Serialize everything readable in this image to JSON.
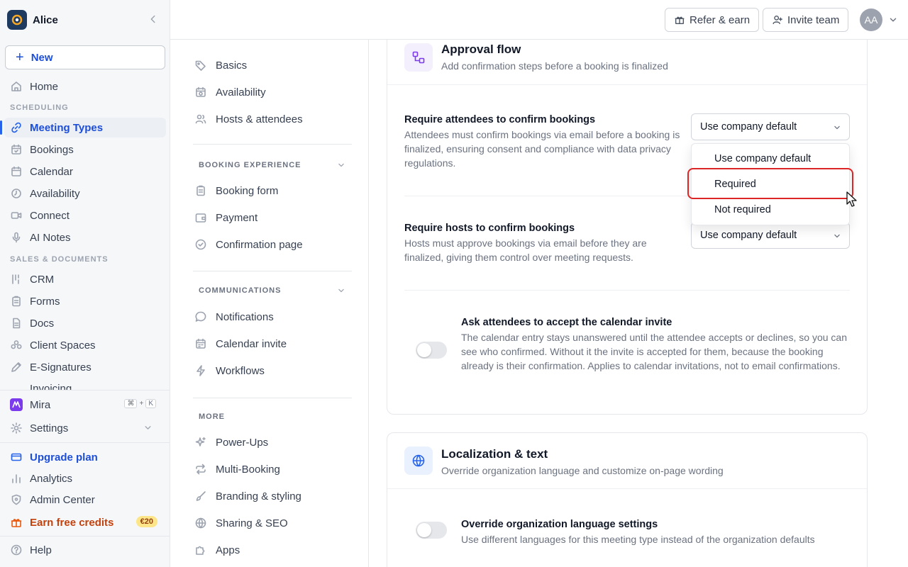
{
  "workspace": {
    "name": "Alice"
  },
  "sidebar": {
    "new_label": "New",
    "home": "Home",
    "section_scheduling": "SCHEDULING",
    "scheduling": [
      {
        "label": "Meeting Types",
        "icon": "link-icon",
        "active": true
      },
      {
        "label": "Bookings",
        "icon": "calendar-check-icon"
      },
      {
        "label": "Calendar",
        "icon": "calendar-icon"
      },
      {
        "label": "Availability",
        "icon": "clock-icon"
      },
      {
        "label": "Connect",
        "icon": "video-icon"
      },
      {
        "label": "AI Notes",
        "icon": "microphone-icon"
      }
    ],
    "section_sales": "SALES & DOCUMENTS",
    "sales": [
      {
        "label": "CRM",
        "icon": "crm-icon"
      },
      {
        "label": "Forms",
        "icon": "clipboard-icon"
      },
      {
        "label": "Docs",
        "icon": "document-icon"
      },
      {
        "label": "Client Spaces",
        "icon": "people-icon"
      },
      {
        "label": "E-Signatures",
        "icon": "pen-icon"
      }
    ],
    "clipped_item": "Invoicing",
    "mira": {
      "label": "Mira",
      "shortcut_cmd": "⌘",
      "shortcut_plus": "+",
      "shortcut_key": "K"
    },
    "settings_label": "Settings",
    "upgrade_label": "Upgrade plan",
    "analytics_label": "Analytics",
    "admin_label": "Admin Center",
    "earn_label": "Earn free credits",
    "earn_badge": "€20",
    "help_label": "Help"
  },
  "topbar": {
    "refer_label": "Refer & earn",
    "invite_label": "Invite team",
    "avatar_initials": "AA"
  },
  "subnav": {
    "top_items": [
      "Basics",
      "Availability",
      "Hosts & attendees"
    ],
    "section_booking": "BOOKING EXPERIENCE",
    "booking_items": [
      "Booking form",
      "Payment",
      "Confirmation page"
    ],
    "section_comms": "COMMUNICATIONS",
    "comms_items": [
      "Notifications",
      "Calendar invite",
      "Workflows"
    ],
    "section_more": "MORE",
    "more_items": [
      "Power-Ups",
      "Multi-Booking",
      "Branding & styling",
      "Sharing & SEO",
      "Apps"
    ]
  },
  "approval": {
    "title": "Approval flow",
    "subtitle": "Add confirmation steps before a booking is finalized",
    "attendees_title": "Require attendees to confirm bookings",
    "attendees_desc": "Attendees must confirm bookings via email before a booking is finalized, ensuring consent and compliance with data privacy regulations.",
    "attendees_value": "Use company default",
    "hosts_title": "Require hosts to confirm bookings",
    "hosts_desc": "Hosts must approve bookings via email before they are finalized, giving them control over meeting requests.",
    "hosts_value": "Use company default",
    "invite_title": "Ask attendees to accept the calendar invite",
    "invite_desc": "The calendar entry stays unanswered until the attendee accepts or declines, so you can see who confirmed. Without it the invite is accepted for them, because the booking already is their confirmation. Applies to calendar invitations, not to email confirmations.",
    "invite_enabled": false
  },
  "dropdown": {
    "options": [
      "Use company default",
      "Required",
      "Not required"
    ],
    "highlighted": "Required"
  },
  "localization": {
    "title": "Localization & text",
    "subtitle": "Override organization language and customize on-page wording",
    "override_title": "Override organization language settings",
    "override_desc": "Use different languages for this meeting type instead of the organization defaults",
    "override_enabled": false
  },
  "colors": {
    "accent": "#2563eb",
    "highlight_border": "#dc2626",
    "approval_icon_bg": "#f3effc",
    "localization_icon_bg": "#eaf1fe"
  }
}
